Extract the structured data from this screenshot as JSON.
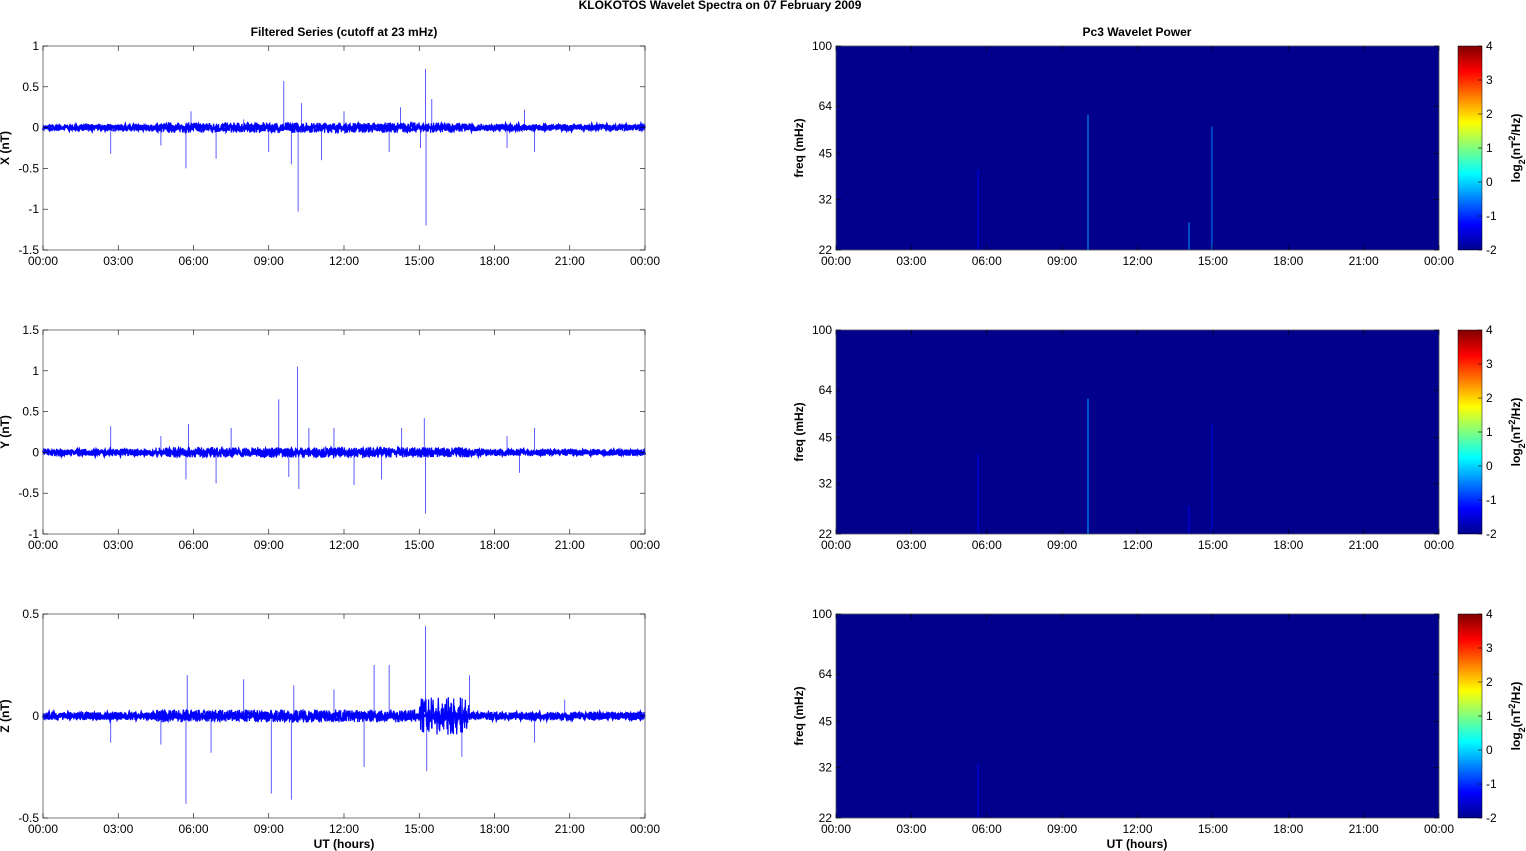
{
  "title": "KLOKOTOS Wavelet Spectra on 07 February  2009",
  "left_title": "Filtered Series (cutoff at 23 mHz)",
  "right_title": "Pc3 Wavelet Power",
  "xlabel": "UT (hours)",
  "x_ticks": [
    "00:00",
    "03:00",
    "06:00",
    "09:00",
    "12:00",
    "15:00",
    "18:00",
    "21:00",
    "00:00"
  ],
  "colors": {
    "trace": "#0000ff",
    "spectrogram_background": "#00008c"
  },
  "chart_data": [
    {
      "type": "line",
      "ylabel": "X (nT)",
      "xlim": [
        0,
        24
      ],
      "ylim": [
        -1.5,
        1
      ],
      "y_ticks": [
        "1",
        "0.5",
        "0",
        "-0.5",
        "-1",
        "-1.5"
      ],
      "y_tick_values": [
        1,
        0.5,
        0,
        -0.5,
        -1,
        -1.5
      ],
      "noise": 0.02,
      "spikes": [
        [
          2.7,
          -0.32
        ],
        [
          4.7,
          -0.22
        ],
        [
          5.7,
          -0.5
        ],
        [
          5.9,
          0.2
        ],
        [
          6.9,
          -0.38
        ],
        [
          8.0,
          0.1
        ],
        [
          9.0,
          -0.3
        ],
        [
          9.6,
          0.57
        ],
        [
          9.9,
          -0.45
        ],
        [
          10.17,
          -1.03
        ],
        [
          10.3,
          0.3
        ],
        [
          11.1,
          -0.4
        ],
        [
          12.0,
          0.2
        ],
        [
          13.8,
          -0.3
        ],
        [
          14.25,
          0.25
        ],
        [
          15.05,
          -0.25
        ],
        [
          15.25,
          0.72
        ],
        [
          15.27,
          -1.2
        ],
        [
          15.5,
          0.35
        ],
        [
          18.5,
          -0.25
        ],
        [
          19.2,
          0.22
        ],
        [
          19.6,
          -0.3
        ]
      ]
    },
    {
      "type": "line",
      "ylabel": "Y (nT)",
      "xlim": [
        0,
        24
      ],
      "ylim": [
        -1,
        1.5
      ],
      "y_ticks": [
        "1.5",
        "1",
        "0.5",
        "0",
        "-0.5",
        "-1"
      ],
      "y_tick_values": [
        1.5,
        1,
        0.5,
        0,
        -0.5,
        -1
      ],
      "noise": 0.02,
      "spikes": [
        [
          2.7,
          0.32
        ],
        [
          4.7,
          0.2
        ],
        [
          5.7,
          -0.33
        ],
        [
          5.8,
          0.35
        ],
        [
          6.9,
          -0.38
        ],
        [
          7.5,
          0.3
        ],
        [
          9.4,
          0.65
        ],
        [
          9.8,
          -0.3
        ],
        [
          10.15,
          1.05
        ],
        [
          10.2,
          -0.45
        ],
        [
          10.6,
          0.3
        ],
        [
          11.6,
          0.3
        ],
        [
          12.4,
          -0.4
        ],
        [
          13.5,
          -0.33
        ],
        [
          14.3,
          0.3
        ],
        [
          15.2,
          0.42
        ],
        [
          15.25,
          -0.75
        ],
        [
          18.5,
          0.2
        ],
        [
          19.0,
          -0.25
        ],
        [
          19.6,
          0.3
        ]
      ]
    },
    {
      "type": "line",
      "ylabel": "Z (nT)",
      "xlim": [
        0,
        24
      ],
      "ylim": [
        -0.5,
        0.5
      ],
      "y_ticks": [
        "0.5",
        "0",
        "-0.5"
      ],
      "y_tick_values": [
        0.5,
        0,
        -0.5
      ],
      "noise": 0.01,
      "spikes": [
        [
          2.7,
          -0.13
        ],
        [
          4.7,
          -0.14
        ],
        [
          5.7,
          -0.43
        ],
        [
          5.75,
          0.2
        ],
        [
          6.7,
          -0.18
        ],
        [
          8.0,
          0.18
        ],
        [
          9.1,
          -0.38
        ],
        [
          9.9,
          -0.41
        ],
        [
          10.0,
          0.15
        ],
        [
          11.6,
          0.13
        ],
        [
          12.8,
          -0.25
        ],
        [
          13.2,
          0.25
        ],
        [
          13.8,
          0.25
        ],
        [
          15.25,
          0.44
        ],
        [
          15.3,
          -0.27
        ],
        [
          16.7,
          -0.2
        ],
        [
          17.0,
          0.2
        ],
        [
          19.6,
          -0.13
        ],
        [
          20.8,
          0.08
        ]
      ]
    },
    {
      "type": "heatmap",
      "ylabel": "freq (mHz)",
      "xlim": [
        0,
        24
      ],
      "ylim": [
        22,
        100
      ],
      "yscale": "log",
      "y_ticks": [
        "100",
        "64",
        "45",
        "32",
        "22"
      ],
      "y_tick_values": [
        100,
        64,
        45,
        32,
        22
      ],
      "colorbar": {
        "label": "log2(nT2/Hz)",
        "ticks": [
          "4",
          "3",
          "2",
          "1",
          "0",
          "-1",
          "-2"
        ],
        "range": [
          -2,
          4
        ]
      },
      "streaks": [
        [
          5.65,
          40,
          -1.3
        ],
        [
          10.03,
          60,
          -0.8
        ],
        [
          14.05,
          27,
          -0.9
        ],
        [
          14.96,
          55,
          -1.2
        ]
      ]
    },
    {
      "type": "heatmap",
      "ylabel": "freq (mHz)",
      "xlim": [
        0,
        24
      ],
      "ylim": [
        22,
        100
      ],
      "yscale": "log",
      "y_ticks": [
        "100",
        "64",
        "45",
        "32",
        "22"
      ],
      "y_tick_values": [
        100,
        64,
        45,
        32,
        22
      ],
      "colorbar": {
        "label": "log2(nT2/Hz)",
        "ticks": [
          "4",
          "3",
          "2",
          "1",
          "0",
          "-1",
          "-2"
        ],
        "range": [
          -2,
          4
        ]
      },
      "streaks": [
        [
          5.65,
          40,
          -1.4
        ],
        [
          10.03,
          60,
          -0.5
        ],
        [
          14.05,
          27,
          -1.3
        ],
        [
          14.96,
          50,
          -1.6
        ]
      ]
    },
    {
      "type": "heatmap",
      "ylabel": "freq (mHz)",
      "xlim": [
        0,
        24
      ],
      "ylim": [
        22,
        100
      ],
      "yscale": "log",
      "y_ticks": [
        "100",
        "64",
        "45",
        "32",
        "22"
      ],
      "y_tick_values": [
        100,
        64,
        45,
        32,
        22
      ],
      "colorbar": {
        "label": "log2(nT2/Hz)",
        "ticks": [
          "4",
          "3",
          "2",
          "1",
          "0",
          "-1",
          "-2"
        ],
        "range": [
          -2,
          4
        ]
      },
      "streaks": [
        [
          5.65,
          33,
          -1.4
        ]
      ]
    }
  ]
}
